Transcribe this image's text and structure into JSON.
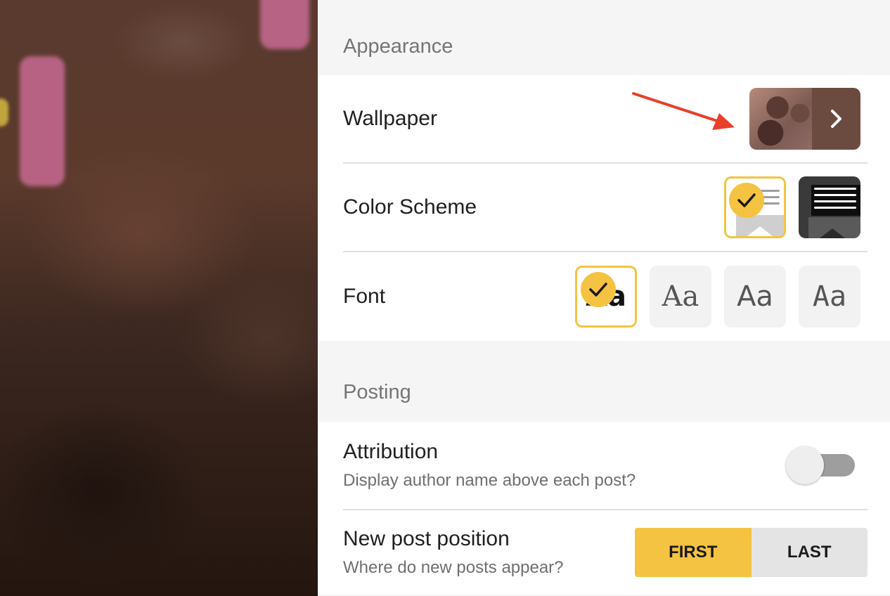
{
  "appearance": {
    "header": "Appearance",
    "wallpaper_label": "Wallpaper",
    "wallpaper_arrow": "›",
    "color_scheme_label": "Color Scheme",
    "color_scheme_selected": "light",
    "font_label": "Font",
    "fonts": [
      {
        "sample": "Aa",
        "selected": true
      },
      {
        "sample": "Aa",
        "selected": false
      },
      {
        "sample": "Aa",
        "selected": false
      },
      {
        "sample": "Aa",
        "selected": false
      }
    ],
    "check_glyph": "✓"
  },
  "posting": {
    "header": "Posting",
    "attribution_label": "Attribution",
    "attribution_sub": "Display author name above each post?",
    "attribution_enabled": false,
    "new_post_label": "New post position",
    "new_post_sub": "Where do new posts appear?",
    "first_label": "FIRST",
    "last_label": "LAST",
    "new_post_selected": "FIRST"
  },
  "colors": {
    "accent": "#f5c342",
    "annotation_arrow": "#e8402a"
  }
}
